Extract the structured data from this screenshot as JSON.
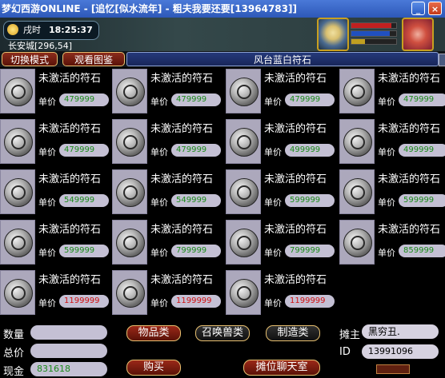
{
  "window": {
    "title": "梦幻西游ONLINE - [追忆[似水流年] - 粗夫我要还要[13964783]]",
    "minimize": "_",
    "close": "×"
  },
  "status": {
    "period": "戌时",
    "time": "18:25:37",
    "location": "长安城[296,54]"
  },
  "toolbar": {
    "switch_mode": "切换模式",
    "view_catalog": "观看图鉴",
    "shop_title": "风台蓝白符石"
  },
  "items": [
    {
      "name": "未激活的符石",
      "price_label": "单价",
      "price": "479999",
      "price_color": "green"
    },
    {
      "name": "未激活的符石",
      "price_label": "单价",
      "price": "479999",
      "price_color": "green"
    },
    {
      "name": "未激活的符石",
      "price_label": "单价",
      "price": "479999",
      "price_color": "green"
    },
    {
      "name": "未激活的符石",
      "price_label": "单价",
      "price": "479999",
      "price_color": "green"
    },
    {
      "name": "未激活的符石",
      "price_label": "单价",
      "price": "479999",
      "price_color": "green"
    },
    {
      "name": "未激活的符石",
      "price_label": "单价",
      "price": "479999",
      "price_color": "green"
    },
    {
      "name": "未激活的符石",
      "price_label": "单价",
      "price": "499999",
      "price_color": "green"
    },
    {
      "name": "未激活的符石",
      "price_label": "单价",
      "price": "499999",
      "price_color": "green"
    },
    {
      "name": "未激活的符石",
      "price_label": "单价",
      "price": "549999",
      "price_color": "green"
    },
    {
      "name": "未激活的符石",
      "price_label": "单价",
      "price": "549999",
      "price_color": "green"
    },
    {
      "name": "未激活的符石",
      "price_label": "单价",
      "price": "599999",
      "price_color": "green"
    },
    {
      "name": "未激活的符石",
      "price_label": "单价",
      "price": "599999",
      "price_color": "green"
    },
    {
      "name": "未激活的符石",
      "price_label": "单价",
      "price": "599999",
      "price_color": "green"
    },
    {
      "name": "未激活的符石",
      "price_label": "单价",
      "price": "799999",
      "price_color": "green"
    },
    {
      "name": "未激活的符石",
      "price_label": "单价",
      "price": "799999",
      "price_color": "green"
    },
    {
      "name": "未激活的符石",
      "price_label": "单价",
      "price": "859999",
      "price_color": "green"
    },
    {
      "name": "未激活的符石",
      "price_label": "单价",
      "price": "1199999",
      "price_color": "red"
    },
    {
      "name": "未激活的符石",
      "price_label": "单价",
      "price": "1199999",
      "price_color": "red"
    },
    {
      "name": "未激活的符石",
      "price_label": "单价",
      "price": "1199999",
      "price_color": "red"
    }
  ],
  "bottom": {
    "quantity_label": "数量",
    "quantity_value": "",
    "total_label": "总价",
    "total_value": "",
    "cash_label": "现金",
    "cash_value": "831618",
    "tab_items": "物品类",
    "tab_pets": "召唤兽类",
    "tab_craft": "制造类",
    "buy_button": "购买",
    "chat_button": "摊位聊天室",
    "owner_label": "摊主",
    "owner_value": "黑穷丑.",
    "id_label": "ID",
    "id_value": "13991096"
  },
  "colors": {
    "price_green": "#1a8a1a",
    "price_red": "#d01010",
    "button_red": "#7a1c10",
    "title_blue": "#2d58b8"
  },
  "bars": {
    "pet_hp": 0.9,
    "pet_mp": 0.85,
    "pet_exp": 0.3,
    "hero_hp": 0.95,
    "hero_mp": 0.9,
    "hero_anger": 0.2
  }
}
